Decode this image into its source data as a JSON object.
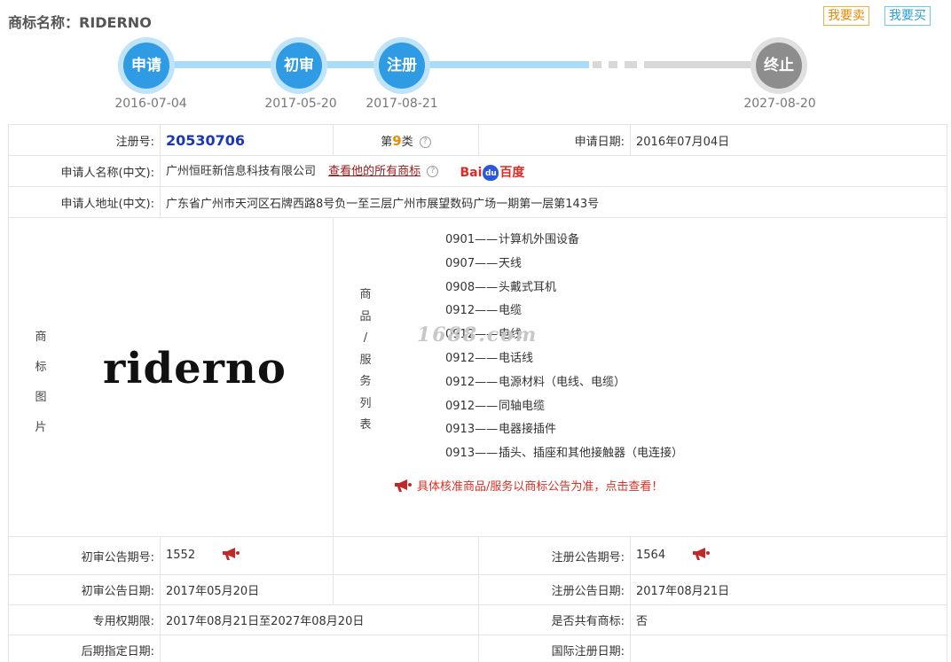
{
  "header": {
    "title": "商标名称：RIDERNO",
    "sell_label": "我要卖",
    "buy_label": "我要买"
  },
  "timeline": {
    "steps": [
      {
        "label": "申请",
        "date": "2016-07-04"
      },
      {
        "label": "初审",
        "date": "2017-05-20"
      },
      {
        "label": "注册",
        "date": "2017-08-21"
      },
      {
        "label": "终止",
        "date": "2027-08-20"
      }
    ]
  },
  "info": {
    "reg_no_label": "注册号:",
    "reg_no": "20530706",
    "class_prefix": "第",
    "class_num": "9",
    "class_suffix": "类",
    "help_glyph": "?",
    "apply_date_label": "申请日期:",
    "apply_date": "2016年07月04日",
    "applicant_label": "申请人名称(中文):",
    "applicant": "广州恒旺新信息科技有限公司",
    "all_marks_link": "查看他的所有商标",
    "baidu_text_a": "Bai",
    "baidu_paw": "du",
    "baidu_text_b": "百度",
    "address_label": "申请人地址(中文):",
    "address": "广东省广州市天河区石牌西路8号负一至三层广州市展望数码广场一期第一层第143号",
    "image_label": [
      "商",
      "标",
      "图",
      "片"
    ],
    "logo_text": "riderno",
    "watermark": "1688.com",
    "goods_label": [
      "商",
      "品",
      "/",
      "服",
      "务",
      "列",
      "表"
    ],
    "goods": [
      {
        "code": "0901——",
        "name": "计算机外围设备"
      },
      {
        "code": "0907——",
        "name": "天线"
      },
      {
        "code": "0908——",
        "name": "头戴式耳机"
      },
      {
        "code": "0912——",
        "name": "电缆"
      },
      {
        "code": "0912——",
        "name": "电线"
      },
      {
        "code": "0912——",
        "name": "电话线"
      },
      {
        "code": "0912——",
        "name": "电源材料（电线、电缆）"
      },
      {
        "code": "0912——",
        "name": "同轴电缆"
      },
      {
        "code": "0913——",
        "name": "电器接插件"
      },
      {
        "code": "0913——",
        "name": "插头、插座和其他接触器（电连接）"
      }
    ],
    "goods_notice": "具体核准商品/服务以商标公告为准，点击查看！",
    "prelim_no_label": "初审公告期号:",
    "prelim_no": "1552",
    "reg_pub_no_label": "注册公告期号:",
    "reg_pub_no": "1564",
    "prelim_date_label": "初审公告日期:",
    "prelim_date": "2017年05月20日",
    "reg_pub_date_label": "注册公告日期:",
    "reg_pub_date": "2017年08月21日",
    "exclusive_label": "专用权期限:",
    "exclusive": "2017年08月21日至2027年08月20日",
    "shared_label": "是否共有商标:",
    "shared": "否",
    "later_label": "后期指定日期:",
    "later": "",
    "intl_label": "国际注册日期:",
    "intl": ""
  },
  "colors": {
    "accent": "#2e9be4",
    "node_ring": "#bfe3f8",
    "end_node": "#8d8d8d",
    "reg_no": "#1a37b8",
    "class_num": "#e88e00",
    "notice": "#d93025"
  }
}
